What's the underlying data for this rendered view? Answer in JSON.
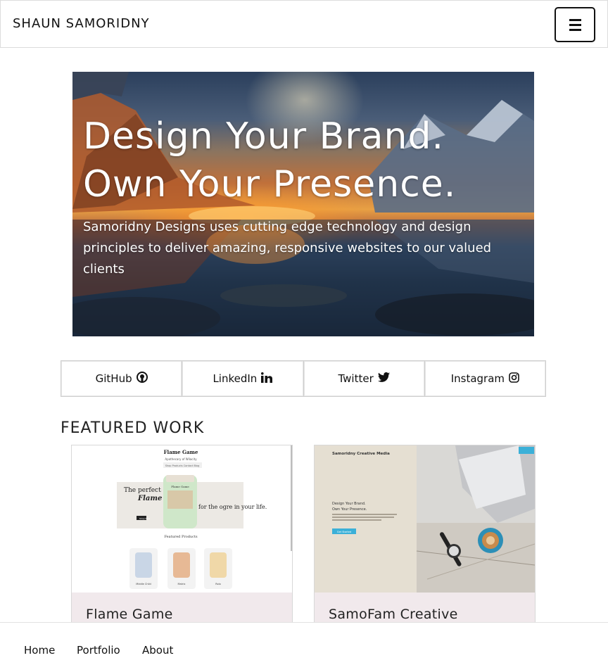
{
  "header": {
    "brand": "SHAUN SAMORIDNY",
    "menu_icon": "hamburger-menu-icon"
  },
  "hero": {
    "title_line1": "Design Your Brand.",
    "title_line2": "Own Your Presence.",
    "subtitle": "Samoridny Designs uses cutting edge technology and design principles to deliver amazing, responsive websites to our valued clients"
  },
  "social": [
    {
      "label": "GitHub",
      "icon": "github-icon"
    },
    {
      "label": "LinkedIn",
      "icon": "linkedin-icon"
    },
    {
      "label": "Twitter",
      "icon": "twitter-icon"
    },
    {
      "label": "Instagram",
      "icon": "instagram-icon"
    }
  ],
  "featured": {
    "title": "FEATURED WORK",
    "cards": [
      {
        "title": "Flame Game",
        "thumb": {
          "site_name": "Flame Game",
          "tagline": "Apothecary of Wilacity",
          "nav": "Shop  Products  Contact  Blog",
          "hero_left_1": "The perfect",
          "hero_left_2": "Flame",
          "jar_label": "Flame Game",
          "hero_right": "for the ogre in your life.",
          "button": "Shop Now",
          "products_heading": "Featured Products",
          "products": [
            "Middle Child",
            "Matrix",
            "Rolo"
          ]
        }
      },
      {
        "title": "SamoFam Creative",
        "thumb": {
          "site_name": "Samoridny Creative Media",
          "headline_1": "Design Your Brand.",
          "headline_2": "Own Your Presence.",
          "button": "Get Started"
        }
      }
    ]
  },
  "bottom_nav": [
    "Home",
    "Portfolio",
    "About"
  ]
}
